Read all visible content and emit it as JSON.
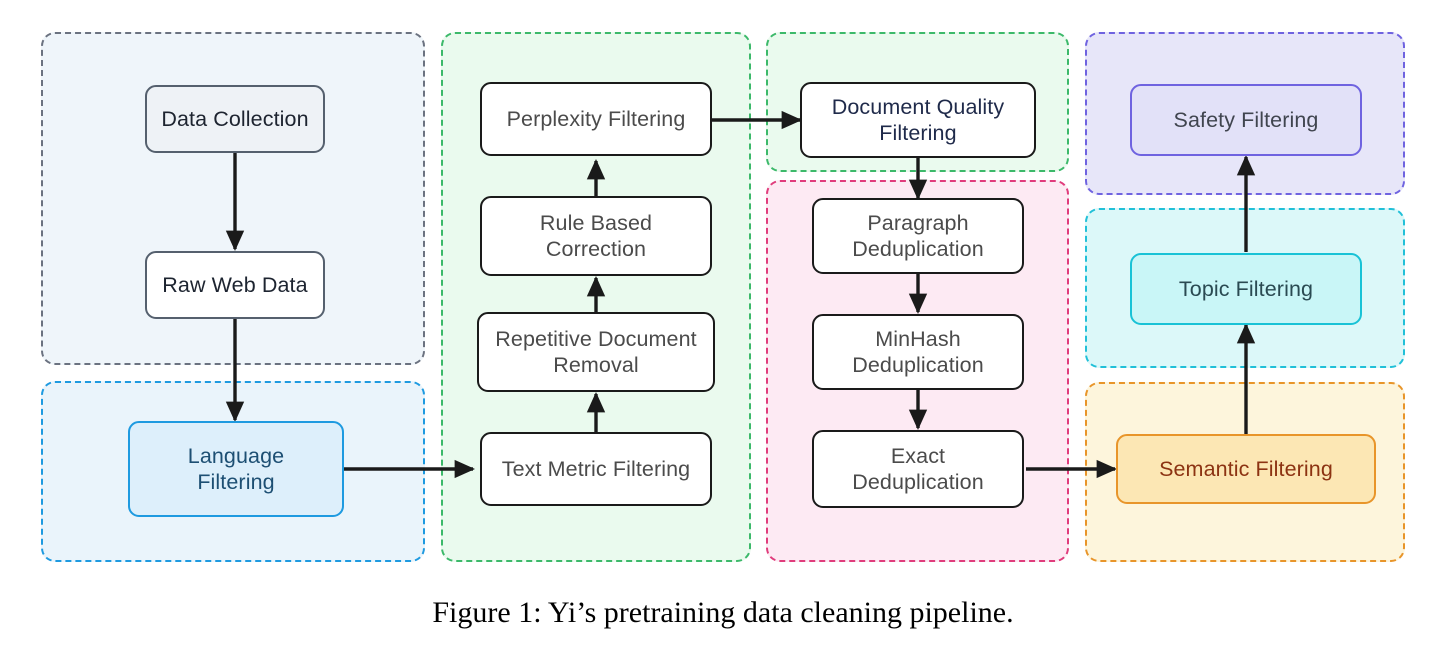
{
  "figure": {
    "caption": "Figure 1: Yi’s pretraining data cleaning pipeline.",
    "title": "Yi pretraining data cleaning pipeline"
  },
  "palette": {
    "gray": "#6b7280",
    "blue": "#1e9ae0",
    "green": "#3cb96a",
    "pink": "#e03c7c",
    "purple": "#6f63e0",
    "cyan": "#21c0d8",
    "orange": "#e8952a",
    "edge": "#1a1a1a"
  },
  "stages": [
    {
      "id": "collection",
      "color": "gray",
      "nodes": [
        {
          "id": "data-collection",
          "label": "Data Collection"
        },
        {
          "id": "raw-web-data",
          "label": "Raw Web Data"
        }
      ]
    },
    {
      "id": "language",
      "color": "blue",
      "nodes": [
        {
          "id": "language-filtering",
          "label": "Language\nFiltering"
        }
      ]
    },
    {
      "id": "text-cleaning",
      "color": "green",
      "nodes": [
        {
          "id": "perplexity-filtering",
          "label": "Perplexity Filtering"
        },
        {
          "id": "rule-based-correction",
          "label": "Rule Based\nCorrection"
        },
        {
          "id": "repetitive-document-removal",
          "label": "Repetitive Document\nRemoval"
        },
        {
          "id": "text-metric-filtering",
          "label": "Text Metric Filtering"
        }
      ]
    },
    {
      "id": "document-quality",
      "color": "green",
      "nodes": [
        {
          "id": "document-quality-filtering",
          "label": "Document Quality\nFiltering"
        }
      ]
    },
    {
      "id": "deduplication",
      "color": "pink",
      "nodes": [
        {
          "id": "paragraph-deduplication",
          "label": "Paragraph\nDeduplication"
        },
        {
          "id": "minhash-deduplication",
          "label": "MinHash\nDeduplication"
        },
        {
          "id": "exact-deduplication",
          "label": "Exact\nDeduplication"
        }
      ]
    },
    {
      "id": "safety",
      "color": "purple",
      "nodes": [
        {
          "id": "safety-filtering",
          "label": "Safety Filtering"
        }
      ]
    },
    {
      "id": "topic",
      "color": "cyan",
      "nodes": [
        {
          "id": "topic-filtering",
          "label": "Topic Filtering"
        }
      ]
    },
    {
      "id": "semantic",
      "color": "orange",
      "nodes": [
        {
          "id": "semantic-filtering",
          "label": "Semantic Filtering"
        }
      ]
    }
  ],
  "flow": [
    {
      "from": "Data Collection",
      "to": "Raw Web Data"
    },
    {
      "from": "Raw Web Data",
      "to": "Language Filtering"
    },
    {
      "from": "Language Filtering",
      "to": "Text Metric Filtering"
    },
    {
      "from": "Text Metric Filtering",
      "to": "Repetitive Document Removal"
    },
    {
      "from": "Repetitive Document Removal",
      "to": "Rule Based Correction"
    },
    {
      "from": "Rule Based Correction",
      "to": "Perplexity Filtering"
    },
    {
      "from": "Perplexity Filtering",
      "to": "Document Quality Filtering"
    },
    {
      "from": "Document Quality Filtering",
      "to": "Paragraph Deduplication"
    },
    {
      "from": "Paragraph Deduplication",
      "to": "MinHash Deduplication"
    },
    {
      "from": "MinHash Deduplication",
      "to": "Exact Deduplication"
    },
    {
      "from": "Exact Deduplication",
      "to": "Semantic Filtering"
    },
    {
      "from": "Semantic Filtering",
      "to": "Topic Filtering"
    },
    {
      "from": "Topic Filtering",
      "to": "Safety Filtering"
    }
  ]
}
